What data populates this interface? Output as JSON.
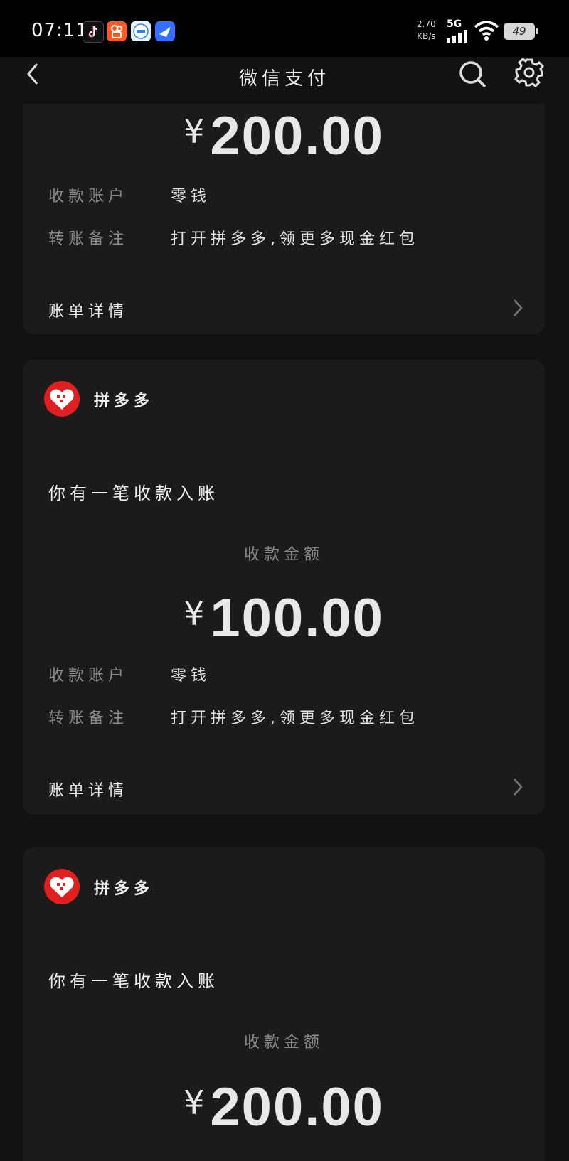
{
  "status_bar": {
    "time": "07:11",
    "speed_value": "2.70",
    "speed_unit": "KB/s",
    "network": "5G",
    "battery": "49",
    "apps": [
      "douyin-icon",
      "kuaishou-icon",
      "ifly-icon",
      "feishu-icon"
    ]
  },
  "nav": {
    "title": "微信支付"
  },
  "cards": [
    {
      "amount_symbol": "¥",
      "amount_value": "200.00",
      "account_label": "收款账户",
      "account_value": "零钱",
      "remark_label": "转账备注",
      "remark_value": "打开拼多多,领更多现金红包",
      "detail_label": "账单详情"
    },
    {
      "merchant": "拼多多",
      "notice": "你有一笔收款入账",
      "amount_label": "收款金额",
      "amount_symbol": "¥",
      "amount_value": "100.00",
      "account_label": "收款账户",
      "account_value": "零钱",
      "remark_label": "转账备注",
      "remark_value": "打开拼多多,领更多现金红包",
      "detail_label": "账单详情"
    },
    {
      "merchant": "拼多多",
      "notice": "你有一笔收款入账",
      "amount_label": "收款金额",
      "amount_symbol": "¥",
      "amount_value": "200.00"
    }
  ],
  "colors": {
    "background": "#121212",
    "card": "#1b1b1b",
    "muted_text": "#8a8a8a",
    "merchant_logo": "#e02020"
  }
}
